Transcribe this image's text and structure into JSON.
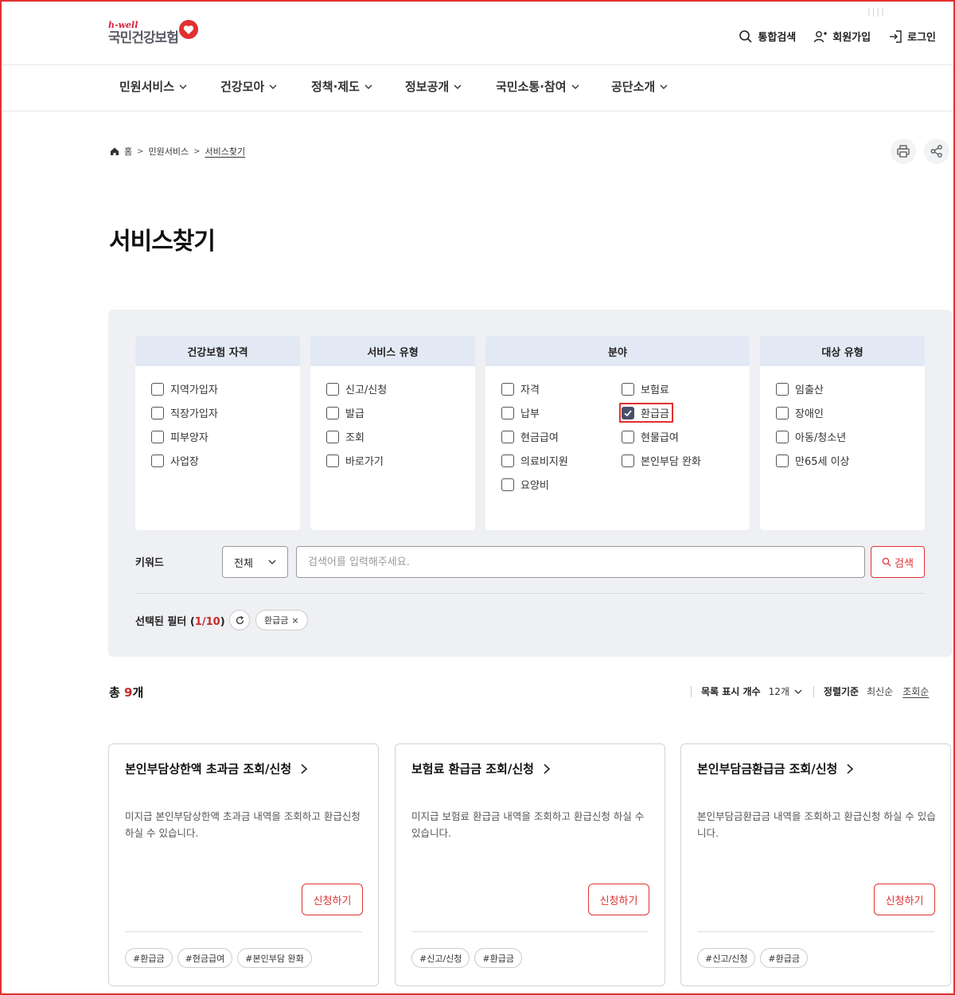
{
  "header": {
    "logo_sub": "h-well",
    "logo_main": "국민건강보험",
    "search_label": "통합검색",
    "join_label": "회원가입",
    "login_label": "로그인"
  },
  "gnb": [
    {
      "label": "민원서비스"
    },
    {
      "label": "건강모아"
    },
    {
      "label": "정책·제도"
    },
    {
      "label": "정보공개"
    },
    {
      "label": "국민소통·참여"
    },
    {
      "label": "공단소개"
    }
  ],
  "breadcrumb": {
    "home": "홈",
    "level1": "민원서비스",
    "current": "서비스찾기"
  },
  "page_title": "서비스찾기",
  "filters": {
    "groups": [
      {
        "title": "건강보험 자격",
        "options": [
          {
            "label": "지역가입자",
            "checked": false
          },
          {
            "label": "직장가입자",
            "checked": false
          },
          {
            "label": "피부양자",
            "checked": false
          },
          {
            "label": "사업장",
            "checked": false
          }
        ]
      },
      {
        "title": "서비스 유형",
        "options": [
          {
            "label": "신고/신청",
            "checked": false
          },
          {
            "label": "발급",
            "checked": false
          },
          {
            "label": "조회",
            "checked": false
          },
          {
            "label": "바로가기",
            "checked": false
          }
        ]
      },
      {
        "title": "분야",
        "options": [
          {
            "label": "자격",
            "checked": false
          },
          {
            "label": "납부",
            "checked": false
          },
          {
            "label": "현금급여",
            "checked": false
          },
          {
            "label": "의료비지원",
            "checked": false
          },
          {
            "label": "요양비",
            "checked": false
          },
          {
            "label": "보험료",
            "checked": false
          },
          {
            "label": "환급금",
            "checked": true
          },
          {
            "label": "현물급여",
            "checked": false
          },
          {
            "label": "본인부담 완화",
            "checked": false
          }
        ]
      },
      {
        "title": "대상 유형",
        "options": [
          {
            "label": "임출산",
            "checked": false
          },
          {
            "label": "장애인",
            "checked": false
          },
          {
            "label": "아동/청소년",
            "checked": false
          },
          {
            "label": "만65세 이상",
            "checked": false
          }
        ]
      }
    ],
    "keyword_label": "키워드",
    "keyword_select": "전체",
    "keyword_placeholder": "검색어를 입력해주세요.",
    "search_button": "검색",
    "selected_label": "선택된 필터 (",
    "selected_count": "1/10",
    "selected_close": ")",
    "selected_chip": "환급금",
    "chip_close": "×"
  },
  "results": {
    "total_prefix": "총 ",
    "total_count": "9",
    "total_suffix": "개",
    "per_page_label": "목록 표시 개수",
    "per_page_value": "12개",
    "sort_label": "정렬기준",
    "sort_latest": "최신순",
    "sort_views": "조회순"
  },
  "cards": [
    {
      "title": "본인부담상한액 초과금 조회/신청",
      "desc": "미지급 본인부담상한액 초과금 내역을 조회하고 환급신청 하실 수 있습니다.",
      "apply": "신청하기",
      "tags": [
        "#환급금",
        "#현금급여",
        "#본인부담 완화"
      ]
    },
    {
      "title": "보험료 환급금 조회/신청",
      "desc": "미지급 보험료 환급금 내역을 조회하고 환급신청 하실 수 있습니다.",
      "apply": "신청하기",
      "tags": [
        "#신고/신청",
        "#환급금"
      ]
    },
    {
      "title": "본인부담금환급금 조회/신청",
      "desc": "본인부담금환급금 내역을 조회하고 환급신청 하실 수 있습니다.",
      "apply": "신청하기",
      "tags": [
        "#신고/신청",
        "#환급금"
      ]
    }
  ],
  "colors": {
    "accent_red": "#e03131",
    "filter_panel_bg": "#eef0f3",
    "filter_head_bg": "#e3e9f4",
    "checked_bg": "#4a4f6a"
  }
}
